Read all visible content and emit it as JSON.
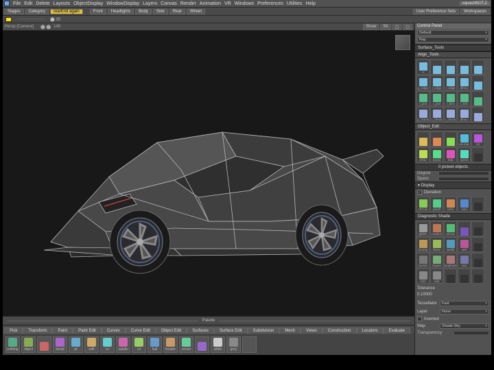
{
  "menu": [
    "File",
    "Edit",
    "Delete",
    "Layouts",
    "ObjectDisplay",
    "WindowDisplay",
    "Layers",
    "Canvas",
    "Render",
    "Animation",
    "VR",
    "Windows",
    "Preferences",
    "Utilities",
    "Help"
  ],
  "title_right": "squashBOT.Z",
  "shelf_tabs": [
    "Stages",
    "Category"
  ],
  "shelf_active_btn": "rearEnd again",
  "shelf_buttons": [
    "Front",
    "Headlights",
    "Body",
    "Side",
    "Rear",
    "Wheel"
  ],
  "shelf_right": [
    "User Preference Sets",
    "Workspaces"
  ],
  "shelf2_swatch_label": "",
  "shelf2_numbers": "30",
  "viewport": {
    "label": "Persp [Camera]",
    "extra": "149",
    "right": [
      "Show",
      "Sh"
    ]
  },
  "palette_label": "Palette",
  "toolbox_tabs": [
    "Pick",
    "Transform",
    "Paint",
    "Paint Edit",
    "Curves",
    "Curve Edit",
    "Object Edit",
    "Surfaces",
    "Surface Edit",
    "Subdivision",
    "Mesh",
    "Views",
    "Construction",
    "Locators",
    "Evaluate"
  ],
  "toolbox_icons": [
    {
      "lb": "nothing",
      "c": "#5a8"
    },
    {
      "lb": "object",
      "c": "#8a5"
    },
    {
      "lb": "",
      "c": "#c66"
    },
    {
      "lb": "templ",
      "c": "#a6c"
    },
    {
      "lb": "pt",
      "c": "#6ac"
    },
    {
      "lb": "edit",
      "c": "#ca6"
    },
    {
      "lb": "cv",
      "c": "#6cc"
    },
    {
      "lb": "subdiv",
      "c": "#c6a"
    },
    {
      "lb": "cs",
      "c": "#9c6"
    },
    {
      "lb": "hull",
      "c": "#69c"
    },
    {
      "lb": "locator",
      "c": "#c96"
    },
    {
      "lb": "vector",
      "c": "#6c9"
    },
    {
      "lb": "",
      "c": "#96c"
    },
    {
      "lb": "white",
      "c": "#ccc"
    },
    {
      "lb": "grey",
      "c": "#888"
    },
    {
      "lb": "",
      "c": "#555"
    }
  ],
  "control_panel": {
    "title": "Control Panel",
    "field1": "Default",
    "field2": "Ray"
  },
  "surface_tools": {
    "title": "Surface_Tools",
    "align": "Align_Tools",
    "align_icons": [
      {
        "lb": "o",
        "c": "#7bd"
      },
      {
        "lb": "",
        "c": "#7bd"
      },
      {
        "lb": "",
        "c": "#7bd"
      },
      {
        "lb": "",
        "c": "#7bd"
      },
      {
        "lb": "",
        "c": "#7bd"
      },
      {
        "lb": "p_edge",
        "c": "#7bd"
      },
      {
        "lb": "t_edge",
        "c": "#7bd"
      },
      {
        "lb": "r_edge",
        "c": "#7bd"
      },
      {
        "lb": "dfmcv",
        "c": "#7bd"
      },
      {
        "lb": "",
        "c": "#7bd"
      },
      {
        "lb": "t_pmt",
        "c": "#5b8"
      },
      {
        "lb": "r_pmt",
        "c": "#5b8"
      },
      {
        "lb": "t_trim",
        "c": "#5b8"
      },
      {
        "lb": "r_trim",
        "c": "#5b8"
      },
      {
        "lb": "",
        "c": "#5b8"
      },
      {
        "lb": "p_check",
        "c": "#9ad"
      },
      {
        "lb": "t_check",
        "c": "#9ad"
      },
      {
        "lb": "r_check",
        "c": "#9ad"
      },
      {
        "lb": "dfmcv",
        "c": "#9ad"
      },
      {
        "lb": "",
        "c": "#9ad"
      }
    ],
    "object_edit": "Object_Edit",
    "obj_icons": [
      {
        "lb": "",
        "c": "#db5"
      },
      {
        "lb": "",
        "c": "#d85"
      },
      {
        "lb": "",
        "c": "#8d5"
      },
      {
        "lb": "ed-mar",
        "c": "#5bd"
      },
      {
        "lb": "mt",
        "c": "#b5d"
      },
      {
        "lb": "xPan",
        "c": "#bd5"
      },
      {
        "lb": "prysd",
        "c": "#5d8"
      },
      {
        "lb": "rbld",
        "c": "#d5b"
      },
      {
        "lb": "symm",
        "c": "#5db"
      },
      {
        "lb": "",
        "c": "#333"
      }
    ],
    "picked": "0 picked objects",
    "degree": "Degree",
    "spans": "Spans"
  },
  "display": {
    "title": "Display",
    "deviation": "Deviation",
    "icons": [
      {
        "lb": "cPrcsn",
        "c": "#8c5"
      },
      {
        "lb": "ptsoff",
        "c": "#5c8"
      },
      {
        "lb": "cxtrs",
        "c": "#c85"
      },
      {
        "lb": "cxtro",
        "c": "#58c"
      },
      {
        "lb": "",
        "c": "#333"
      }
    ]
  },
  "diag": {
    "title": "Diagnostic Shade",
    "row1": [
      {
        "lb": "gbdev",
        "c": "#999"
      },
      {
        "lb": "modcol",
        "c": "#b75"
      },
      {
        "lb": "nmcol",
        "c": "#5b7"
      },
      {
        "lb": "",
        "c": "#75b"
      },
      {
        "lb": "",
        "c": "#333"
      }
    ],
    "row2": [
      {
        "lb": "hcomp",
        "c": "#b95"
      },
      {
        "lb": "hbrav",
        "c": "#9b5"
      },
      {
        "lb": "sentiil",
        "c": "#59b"
      },
      {
        "lb": "vert",
        "c": "#b59"
      },
      {
        "lb": "",
        "c": "#333"
      }
    ],
    "row3": [
      {
        "lb": "tunnel",
        "c": "#777"
      },
      {
        "lb": "clayao",
        "c": "#7a7"
      },
      {
        "lb": "isophote",
        "c": "#a77"
      },
      {
        "lb": "vis1",
        "c": "#77a"
      },
      {
        "lb": "",
        "c": "#333"
      }
    ],
    "row4": [
      {
        "lb": "vis1",
        "c": "#888"
      },
      {
        "lb": "vis2",
        "c": "#888"
      },
      {
        "lb": "",
        "c": "#333"
      },
      {
        "lb": "",
        "c": "#333"
      },
      {
        "lb": "",
        "c": "#333"
      }
    ],
    "tolerance_label": "Tolerance",
    "tolerance": "0.10000",
    "tessellator_label": "Tessellator",
    "tessellator": "Fast",
    "layer_label": "Layer",
    "layer": "None",
    "inverted": "Inverted",
    "map_label": "Map",
    "map": "Shade-Sky",
    "transparency": "Transparency"
  }
}
